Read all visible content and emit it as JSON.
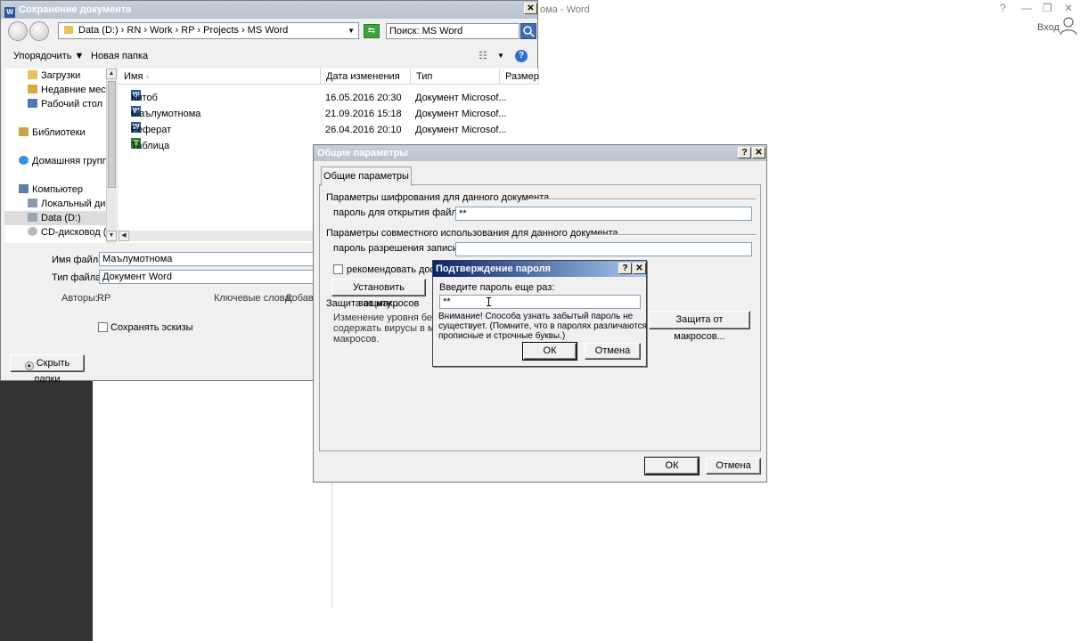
{
  "word": {
    "title": "ома - Word",
    "signin": "Вход",
    "controls": {
      "help": "?",
      "minimize": "—",
      "restore": "❐",
      "close": "✕"
    }
  },
  "save_dialog": {
    "title": "Сохранение документа",
    "address_path": "Data (D:)  ›  RN  ›  Work  ›  RP  ›  Projects  ›  MS Word",
    "search_placeholder": "Поиск: MS Word",
    "toolbar": {
      "organize": "Упорядочить ▼",
      "new_folder": "Новая папка"
    },
    "tree": [
      {
        "label": "Загрузки",
        "icon": "downloads-folder-icon"
      },
      {
        "label": "Недавние места",
        "icon": "recent-places-icon"
      },
      {
        "label": "Рабочий стол",
        "icon": "desktop-icon"
      },
      {
        "label": "Библиотеки",
        "icon": "libraries-icon"
      },
      {
        "label": "Домашняя группа",
        "icon": "homegroup-icon"
      },
      {
        "label": "Компьютер",
        "icon": "computer-icon"
      },
      {
        "label": "Локальный диск",
        "icon": "local-disk-icon"
      },
      {
        "label": "Data (D:)",
        "icon": "drive-icon"
      },
      {
        "label": "CD-дисковод (G",
        "icon": "cd-drive-icon"
      }
    ],
    "columns": {
      "name": "Имя",
      "date": "Дата изменения",
      "type": "Тип",
      "size": "Размер"
    },
    "files": [
      {
        "name": "Китоб",
        "date": "16.05.2016 20:30",
        "type": "Документ Microsof..."
      },
      {
        "name": "Маълумотнома",
        "date": "21.09.2016 15:18",
        "type": "Документ Microsof..."
      },
      {
        "name": "Реферат",
        "date": "26.04.2016 20:10",
        "type": "Документ Microsof..."
      },
      {
        "name": "Таблица",
        "date": "",
        "type": ""
      }
    ],
    "filename_label": "Имя файла:",
    "filename_value": "Маълумотнома",
    "filetype_label": "Тип файла:",
    "filetype_value": "Документ Word",
    "authors_label": "Авторы:",
    "authors_value": "RP",
    "keywords_label": "Ключевые слова:",
    "keywords_value": "Добавь",
    "thumbnails_label": "Сохранять эскизы",
    "hide_folders": "Скрыть папки"
  },
  "options_dialog": {
    "title": "Общие параметры",
    "tab": "Общие параметры",
    "encryption_group": "Параметры шифрования для данного документа",
    "open_password_label": "пароль для открытия файла:",
    "open_password_value": "**",
    "sharing_group": "Параметры совместного использования для данного документа",
    "write_password_label": "пароль разрешения записи:",
    "write_password_value": "",
    "recommend_readonly": "рекомендовать досту",
    "protect_button": "Установить защиту...",
    "macro_group": "Защита от макросов",
    "macro_text_1": "Изменение уровня безо",
    "macro_text_2": "содержать вирусы в мак",
    "macro_text_3": "макросов.",
    "macro_button": "Защита от макросов...",
    "ok": "ОК",
    "cancel": "Отмена"
  },
  "confirm_dialog": {
    "title": "Подтверждение пароля",
    "prompt": "Введите пароль еще раз:",
    "password_value": "**",
    "warning_1": "Внимание! Способа узнать забытый пароль не",
    "warning_2": "существует. (Помните, что в паролях различаются",
    "warning_3": "прописные и строчные буквы.)",
    "ok": "ОК",
    "cancel": "Отмена"
  }
}
